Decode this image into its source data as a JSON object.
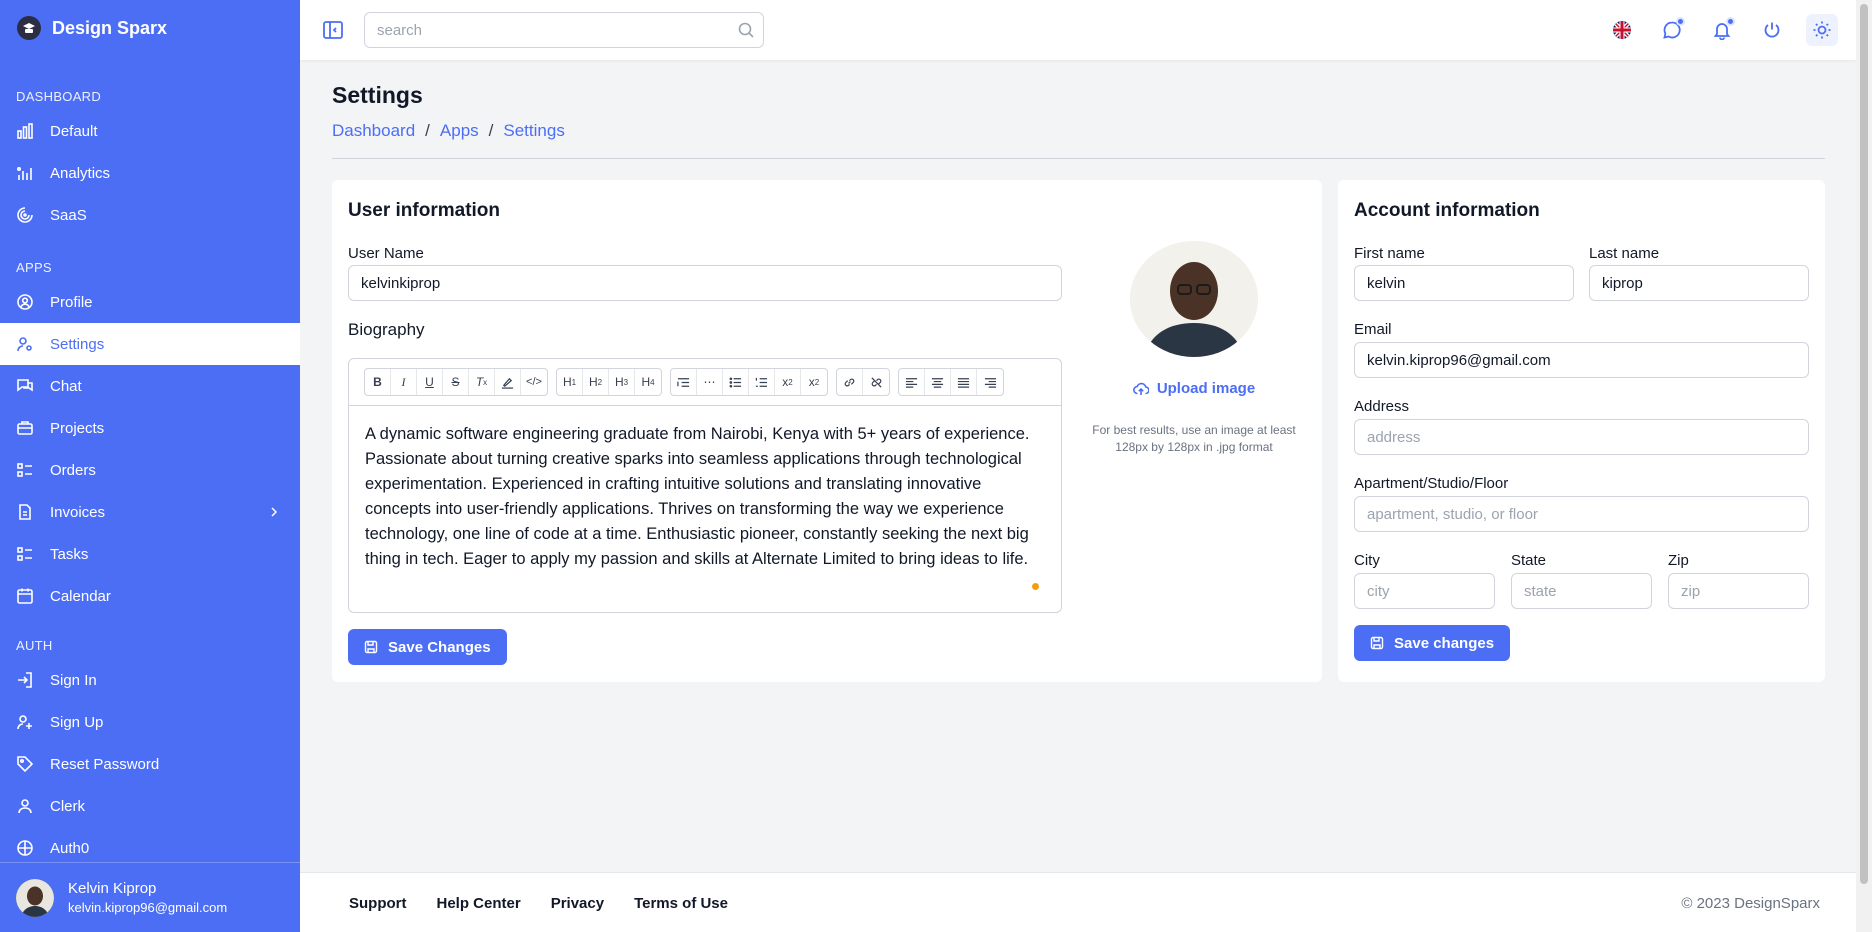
{
  "app": {
    "name": "Design Sparx"
  },
  "sidebar": {
    "sections": [
      {
        "label": "DASHBOARD"
      },
      {
        "label": "APPS"
      },
      {
        "label": "AUTH"
      }
    ],
    "dashboard_items": [
      {
        "label": "Default",
        "icon": "bar-chart-icon"
      },
      {
        "label": "Analytics",
        "icon": "analytics-icon"
      },
      {
        "label": "SaaS",
        "icon": "saas-icon"
      }
    ],
    "app_items": [
      {
        "label": "Profile",
        "icon": "user-circle-icon"
      },
      {
        "label": "Settings",
        "icon": "user-settings-icon",
        "active": true
      },
      {
        "label": "Chat",
        "icon": "chat-icon"
      },
      {
        "label": "Projects",
        "icon": "briefcase-icon"
      },
      {
        "label": "Orders",
        "icon": "list-icon"
      },
      {
        "label": "Invoices",
        "icon": "file-icon"
      },
      {
        "label": "Tasks",
        "icon": "list-icon"
      },
      {
        "label": "Calendar",
        "icon": "calendar-icon"
      }
    ],
    "auth_items": [
      {
        "label": "Sign In",
        "icon": "login-icon"
      },
      {
        "label": "Sign Up",
        "icon": "user-plus-icon"
      },
      {
        "label": "Reset Password",
        "icon": "tag-icon"
      },
      {
        "label": "Clerk",
        "icon": "user-icon"
      },
      {
        "label": "Auth0",
        "icon": "shield-icon"
      }
    ],
    "user": {
      "name": "Kelvin Kiprop",
      "email": "kelvin.kiprop96@gmail.com"
    }
  },
  "topbar": {
    "search_placeholder": "search"
  },
  "page": {
    "title": "Settings",
    "breadcrumb": [
      "Dashboard",
      "Apps",
      "Settings"
    ],
    "breadcrumb_sep": "/"
  },
  "user_info": {
    "title": "User information",
    "username_label": "User Name",
    "username_value": "kelvinkiprop",
    "bio_label": "Biography",
    "bio_text": "A dynamic software engineering graduate from Nairobi, Kenya with 5+ years of experience. Passionate about turning creative sparks into seamless applications through technological experimentation. Experienced in crafting intuitive solutions and translating innovative concepts into user-friendly applications. Thrives on transforming the way we experience technology, one line of code at a time. Enthusiastic pioneer, constantly seeking the next big thing in tech. Eager to apply my passion and skills at Alternate Limited to bring ideas to life.",
    "save_label": "Save Changes",
    "upload_label": "Upload image",
    "upload_hint": "For best results, use an image at least 128px by 128px in .jpg format"
  },
  "account_info": {
    "title": "Account information",
    "first_name_label": "First name",
    "first_name_value": "kelvin",
    "last_name_label": "Last name",
    "last_name_value": "kiprop",
    "email_label": "Email",
    "email_value": "kelvin.kiprop96@gmail.com",
    "address_label": "Address",
    "address_placeholder": "address",
    "apartment_label": "Apartment/Studio/Floor",
    "apartment_placeholder": "apartment, studio, or floor",
    "city_label": "City",
    "city_placeholder": "city",
    "state_label": "State",
    "state_placeholder": "state",
    "zip_label": "Zip",
    "zip_placeholder": "zip",
    "save_label": "Save changes"
  },
  "footer": {
    "links": [
      "Support",
      "Help Center",
      "Privacy",
      "Terms of Use"
    ],
    "copyright": "© 2023 DesignSparx"
  },
  "colors": {
    "accent": "#4c6ef5",
    "edit_status": "#f59e0b"
  }
}
